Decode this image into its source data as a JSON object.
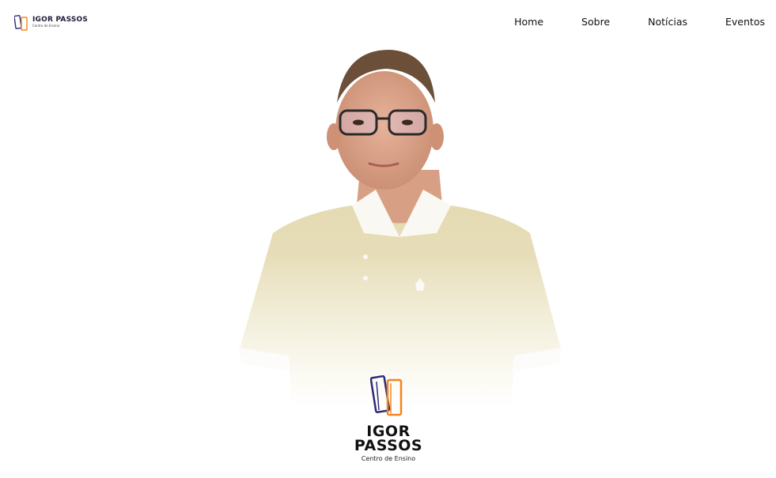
{
  "header": {
    "brand": {
      "name": "IGOR PASSOS",
      "subtitle": "Centro de Ensino"
    },
    "nav": [
      {
        "label": "Home"
      },
      {
        "label": "Sobre"
      },
      {
        "label": "Notícias"
      },
      {
        "label": "Eventos"
      }
    ]
  },
  "hero": {
    "photo": "portrait-photo",
    "logo": {
      "line1": "IGOR",
      "line2": "PASSOS",
      "subtitle": "Centro de Ensino"
    }
  },
  "colors": {
    "book_blue": "#2e2a7a",
    "book_orange": "#f0861f",
    "shirt": "#e9e1bf",
    "text": "#111111"
  }
}
